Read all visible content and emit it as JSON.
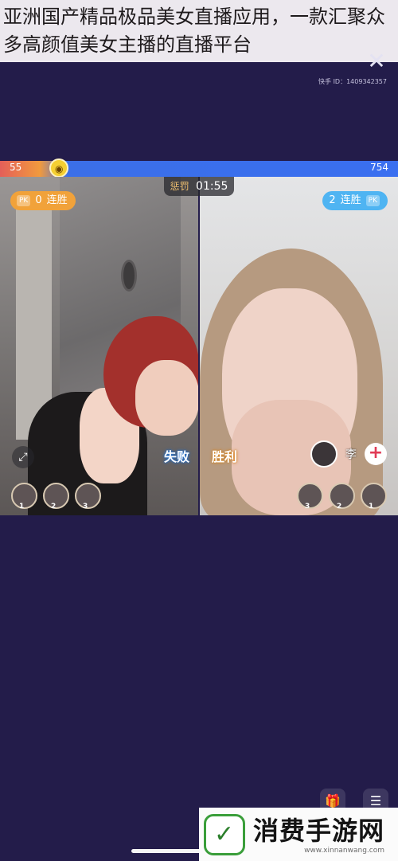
{
  "caption": {
    "text": "亚洲国产精品极品美女直播应用，一款汇聚众多高颜值美女主播的直播平台"
  },
  "top": {
    "close_icon": "close-icon",
    "streamer_id": "快手 ID：1409342357"
  },
  "pk_bar": {
    "left_score": "55",
    "right_score": "754",
    "left_color": "#e45f59",
    "right_color": "#3a6ff0",
    "divider_icon": "emoji-face-icon",
    "divider_glyph": "◉"
  },
  "battle": {
    "left_badge": {
      "tag": "PK",
      "count": "0",
      "label": "连胜"
    },
    "right_badge": {
      "tag": "PK",
      "count": "2",
      "label": "连胜"
    },
    "timer_label": "惩罚",
    "timer_value": "01:55",
    "left_result": "失败",
    "right_result": "胜利",
    "expand_glyph": "⤢",
    "opponent": {
      "name": "李",
      "follow_glyph": "+"
    },
    "left_ranks": [
      "1",
      "2",
      "3"
    ],
    "right_ranks": [
      "3",
      "2",
      "1"
    ]
  },
  "bottom": {
    "icons": [
      {
        "name": "gift-icon",
        "glyph": "🎁"
      },
      {
        "name": "chat-icon",
        "glyph": "☰"
      }
    ]
  },
  "watermark": {
    "mark": "✓",
    "title": "消费手游网",
    "url": "www.xinnanwang.com"
  }
}
